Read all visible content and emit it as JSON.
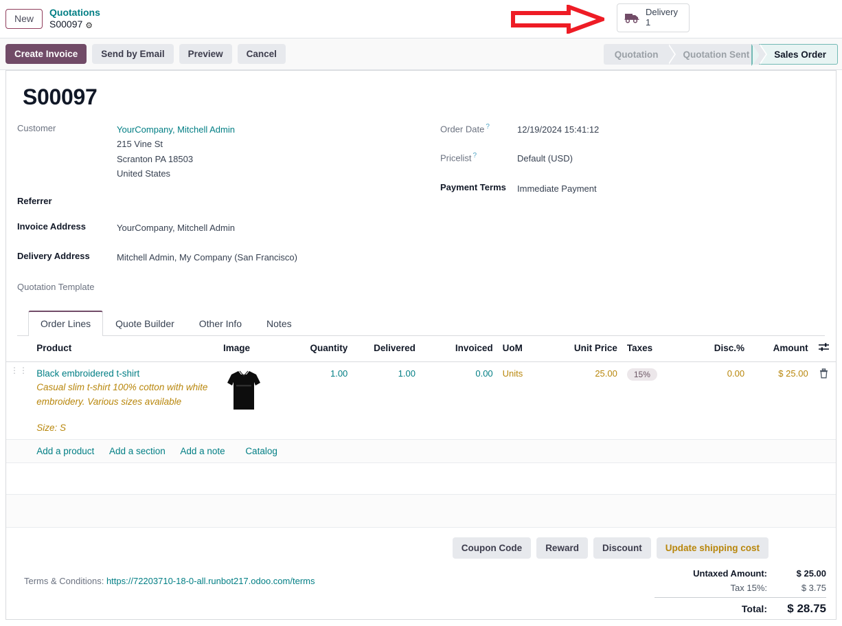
{
  "breadcrumb": {
    "new_label": "New",
    "parent": "Quotations",
    "current": "S00097",
    "gear_icon": "gear-icon"
  },
  "smart_buttons": [
    {
      "icon": "truck-icon",
      "label": "Delivery",
      "value": "1"
    }
  ],
  "annotation": {
    "type": "red-arrow",
    "color": "#ee1c25",
    "points_to": "Delivery"
  },
  "actions": [
    {
      "label": "Create Invoice",
      "style": "primary"
    },
    {
      "label": "Send by Email",
      "style": "secondary"
    },
    {
      "label": "Preview",
      "style": "secondary"
    },
    {
      "label": "Cancel",
      "style": "secondary"
    }
  ],
  "statusbar": {
    "stages": [
      {
        "label": "Quotation",
        "active": false
      },
      {
        "label": "Quotation Sent",
        "active": false
      },
      {
        "label": "Sales Order",
        "active": true
      }
    ]
  },
  "record": {
    "title": "S00097",
    "left_fields": [
      {
        "label": "Customer",
        "bold": false,
        "link": "YourCompany, Mitchell Admin",
        "address": [
          "215 Vine St",
          "Scranton PA 18503",
          "United States"
        ]
      },
      {
        "label": "Referrer",
        "bold": true,
        "value": ""
      },
      {
        "label": "Invoice Address",
        "bold": true,
        "value": "YourCompany, Mitchell Admin"
      },
      {
        "label": "Delivery Address",
        "bold": true,
        "value": "Mitchell Admin, My Company (San Francisco)"
      },
      {
        "label": "Quotation Template",
        "bold": false,
        "value": ""
      }
    ],
    "right_fields": [
      {
        "label": "Order Date",
        "bold": false,
        "help": "?",
        "value": "12/19/2024 15:41:12"
      },
      {
        "label": "Pricelist",
        "bold": false,
        "help": "?",
        "value": "Default (USD)"
      },
      {
        "label": "Payment Terms",
        "bold": true,
        "help": "",
        "value": "Immediate Payment"
      }
    ]
  },
  "notebook": {
    "tabs": [
      {
        "label": "Order Lines",
        "active": true
      },
      {
        "label": "Quote Builder",
        "active": false
      },
      {
        "label": "Other Info",
        "active": false
      },
      {
        "label": "Notes",
        "active": false
      }
    ]
  },
  "order_lines": {
    "columns": [
      "Product",
      "Image",
      "Quantity",
      "Delivered",
      "Invoiced",
      "UoM",
      "Unit Price",
      "Taxes",
      "Disc.%",
      "Amount"
    ],
    "optional_columns_icon": "column-toggle-icon",
    "rows": [
      {
        "drag_handle_icon": "drag-handle-icon",
        "product": "Black embroidered t-shirt",
        "description": "Casual slim t-shirt 100% cotton with white embroidery. Various sizes available",
        "variant": "Size: S",
        "image_alt": "black-tshirt-thumbnail",
        "quantity": "1.00",
        "delivered": "1.00",
        "invoiced": "0.00",
        "uom": "Units",
        "unit_price": "25.00",
        "taxes": "15%",
        "discount": "0.00",
        "amount": "$ 25.00",
        "delete_icon": "trash-icon"
      }
    ],
    "add_links": [
      {
        "label": "Add a product"
      },
      {
        "label": "Add a section"
      },
      {
        "label": "Add a note"
      },
      {
        "label": "Catalog"
      }
    ]
  },
  "promotions": [
    {
      "label": "Coupon Code",
      "style": "default"
    },
    {
      "label": "Reward",
      "style": "default"
    },
    {
      "label": "Discount",
      "style": "default"
    },
    {
      "label": "Update shipping cost",
      "style": "amber"
    }
  ],
  "terms": {
    "label": "Terms & Conditions:",
    "url": "https://72203710-18-0-all.runbot217.odoo.com/terms"
  },
  "totals": [
    {
      "label": "Untaxed Amount:",
      "amount": "$ 25.00",
      "bold": true,
      "rule": false
    },
    {
      "label": "Tax 15%:",
      "amount": "$ 3.75",
      "bold": false,
      "rule": false
    },
    {
      "label": "Total:",
      "amount": "$ 28.75",
      "bold": true,
      "rule": true
    }
  ],
  "colors": {
    "primary": "#714b67",
    "link": "#017e84",
    "amber": "#b8860b",
    "annotation": "#ee1c25"
  }
}
